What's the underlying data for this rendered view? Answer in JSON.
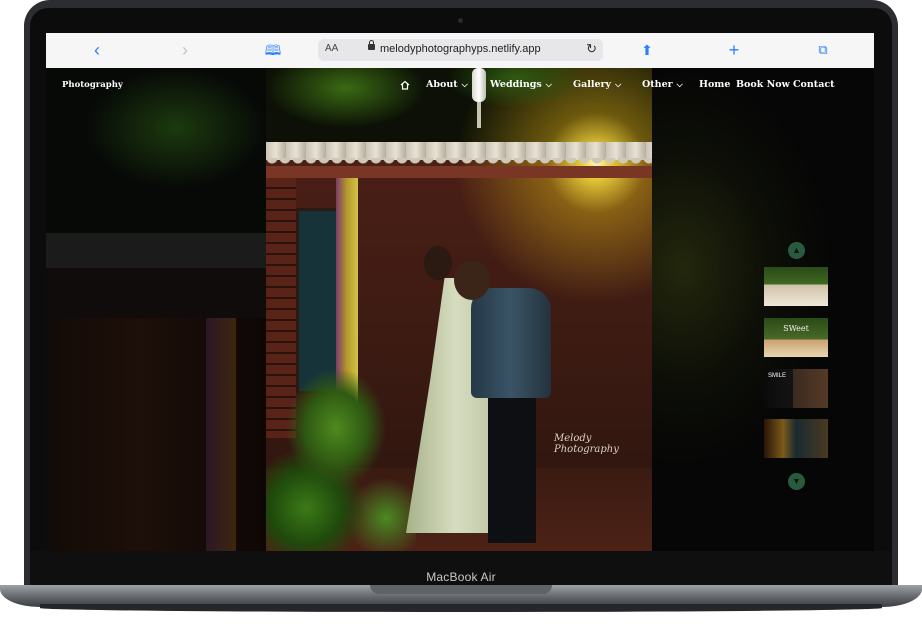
{
  "device": {
    "model_label": "MacBook Air"
  },
  "browser": {
    "text_size_label": "AA",
    "url": "melodyphotographyps.netlify.app",
    "icons": [
      "back-icon",
      "forward-icon",
      "bookmarks-icon",
      "lock-icon",
      "reload-icon",
      "share-icon",
      "new-tab-icon",
      "tabs-icon"
    ]
  },
  "site": {
    "brand": "Photography",
    "nav": {
      "about": "About",
      "weddings": "Weddings",
      "gallery": "Gallery",
      "other": "Other",
      "home": "Home",
      "book_now": "Book Now",
      "contact": "Contact"
    },
    "hero_watermark": "Melody Photography",
    "thumbnail_texts": {
      "t2": "SWeet",
      "t3": "SMILE"
    }
  }
}
